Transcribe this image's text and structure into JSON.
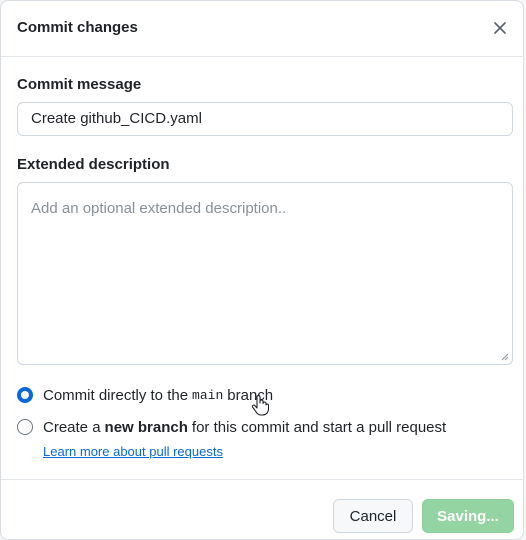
{
  "dialog": {
    "title": "Commit changes",
    "close_icon": "close-icon"
  },
  "commit_message": {
    "label": "Commit message",
    "value": "Create github_CICD.yaml"
  },
  "extended_description": {
    "label": "Extended description",
    "placeholder": "Add an optional extended description..",
    "value": ""
  },
  "options": {
    "direct": {
      "prefix": "Commit directly to the",
      "branch": "main",
      "suffix": "branch",
      "checked": true
    },
    "new_branch": {
      "prefix": "Create a",
      "emphasis": "new branch",
      "suffix": "for this commit and start a pull request",
      "checked": false
    },
    "learn_more": "Learn more about pull requests"
  },
  "footer": {
    "cancel_label": "Cancel",
    "saving_label": "Saving..."
  },
  "colors": {
    "accent": "#0969da",
    "saving_button": "#94d3a2"
  }
}
